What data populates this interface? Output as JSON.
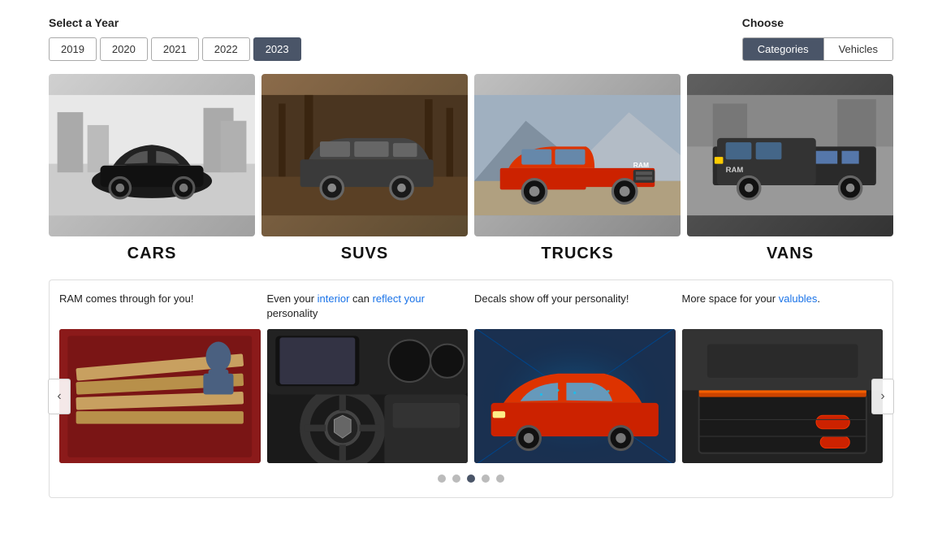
{
  "header": {
    "select_year_label": "Select a Year",
    "years": [
      "2019",
      "2020",
      "2021",
      "2022",
      "2023"
    ],
    "active_year": "2023",
    "choose_label": "Choose",
    "choose_options": [
      "Categories",
      "Vehicles"
    ],
    "active_choose": "Categories"
  },
  "vehicles": [
    {
      "id": "cars",
      "label": "CARS",
      "bg_class": "car-bg"
    },
    {
      "id": "suvs",
      "label": "SUVS",
      "bg_class": "suv-bg"
    },
    {
      "id": "trucks",
      "label": "TRUCKS",
      "bg_class": "truck-bg"
    },
    {
      "id": "vans",
      "label": "VANS",
      "bg_class": "van-bg"
    }
  ],
  "promo": {
    "items": [
      {
        "text": "RAM comes through for you!",
        "highlight_words": [],
        "bg_class": "promo1-bg"
      },
      {
        "text": "Even your interior can reflect your personality",
        "highlight_words": [
          "interior",
          "reflect",
          "your"
        ],
        "bg_class": "promo2-bg"
      },
      {
        "text": "Decals show off your personality!",
        "highlight_words": [],
        "bg_class": "promo3-bg"
      },
      {
        "text": "More space for your valubles.",
        "highlight_words": [
          "valubles"
        ],
        "bg_class": "promo4-bg"
      }
    ],
    "dots": [
      1,
      2,
      3,
      4,
      5
    ],
    "active_dot": 3,
    "prev_arrow": "‹",
    "next_arrow": "›"
  }
}
